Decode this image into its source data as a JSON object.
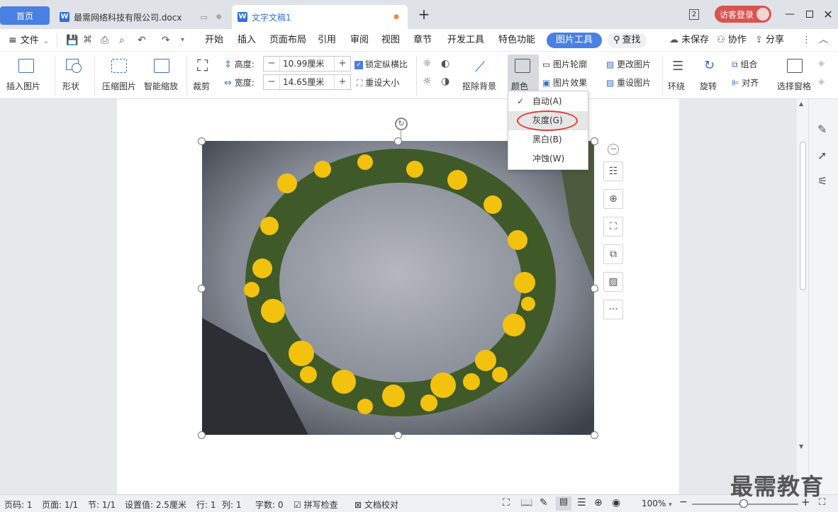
{
  "titlebar": {
    "tab_home": "首页",
    "tab_doc1": "最需网络科技有限公司.docx",
    "tab_doc2": "文字文稿1",
    "new_tab": "+",
    "badge": "2",
    "login": "访客登录"
  },
  "menubar": {
    "file": "文件",
    "items": [
      "开始",
      "插入",
      "页面布局",
      "引用",
      "审阅",
      "视图",
      "章节",
      "开发工具",
      "特色功能"
    ],
    "active": "图片工具",
    "search": "查找",
    "unsaved": "未保存",
    "collab": "协作",
    "share": "分享"
  },
  "ribbon": {
    "insert_picture": "插入图片",
    "shape": "形状",
    "compress": "压缩图片",
    "smart_scale": "智能缩放",
    "crop": "裁剪",
    "height_label": "高度:",
    "height_value": "10.99厘米",
    "width_label": "宽度:",
    "width_value": "14.65厘米",
    "lock_ratio": "锁定纵横比",
    "reset_size": "重设大小",
    "remove_bg": "抠除背景",
    "color": "颜色",
    "outline": "图片轮廓",
    "effect": "图片效果",
    "change_pic": "更改图片",
    "reset_pic": "重设图片",
    "wrap": "环绕",
    "rotate": "旋转",
    "group": "组合",
    "align": "对齐",
    "select_pane": "选择窗格"
  },
  "dropdown": {
    "items": [
      "自动(A)",
      "灰度(G)",
      "黑白(B)",
      "冲蚀(W)"
    ],
    "checked_index": 0,
    "highlight_index": 1,
    "highlight_color": "#e23a3a"
  },
  "status": {
    "page": "页码: 1",
    "pages": "页面: 1/1",
    "section": "节: 1/1",
    "setting": "设置值: 2.5厘米",
    "row": "行: 1",
    "col": "列: 1",
    "words": "字数: 0",
    "spell": "拼写检查",
    "proof": "文档校对",
    "zoom": "100%"
  },
  "watermark": "最需教育",
  "colors": {
    "accent": "#4a7fe3",
    "login": "#d9534f"
  }
}
